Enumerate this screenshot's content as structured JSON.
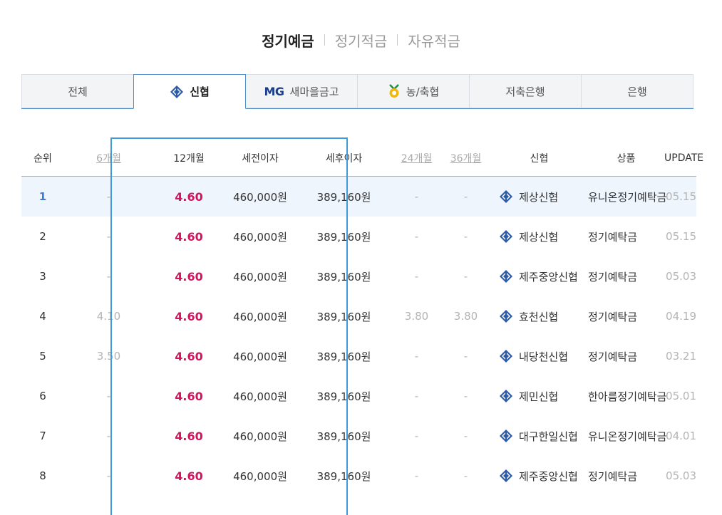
{
  "top_tabs": {
    "items": [
      {
        "label": "정기예금",
        "active": true
      },
      {
        "label": "정기적금",
        "active": false
      },
      {
        "label": "자유적금",
        "active": false
      }
    ]
  },
  "inst_tabs": {
    "all": "전체",
    "shinhyup": "신협",
    "mg_logo": "MG",
    "mg": "새마을금고",
    "nh": "농/축협",
    "savings": "저축은행",
    "bank": "은행",
    "icons": {
      "shinhyup": "shinhyup-logo-icon",
      "nh": "nonghyup-logo-icon"
    }
  },
  "table": {
    "headers": {
      "rank": "순위",
      "m6": "6개월",
      "m12": "12개월",
      "pre_tax": "세전이자",
      "post_tax": "세후이자",
      "m24": "24개월",
      "m36": "36개월",
      "bank": "신협",
      "product": "상품",
      "update": "UPDATE"
    },
    "rows": [
      {
        "rank": "1",
        "m6": "-",
        "m12": "4.60",
        "pre": "460,000원",
        "post": "389,160원",
        "m24": "-",
        "m36": "-",
        "bank": "제상신협",
        "product": "유니온정기예탁금",
        "update": "05.15"
      },
      {
        "rank": "2",
        "m6": "-",
        "m12": "4.60",
        "pre": "460,000원",
        "post": "389,160원",
        "m24": "-",
        "m36": "-",
        "bank": "제상신협",
        "product": "정기예탁금",
        "update": "05.15"
      },
      {
        "rank": "3",
        "m6": "-",
        "m12": "4.60",
        "pre": "460,000원",
        "post": "389,160원",
        "m24": "-",
        "m36": "-",
        "bank": "제주중앙신협",
        "product": "정기예탁금",
        "update": "05.03"
      },
      {
        "rank": "4",
        "m6": "4.10",
        "m12": "4.60",
        "pre": "460,000원",
        "post": "389,160원",
        "m24": "3.80",
        "m36": "3.80",
        "bank": "효천신협",
        "product": "정기예탁금",
        "update": "04.19"
      },
      {
        "rank": "5",
        "m6": "3.50",
        "m12": "4.60",
        "pre": "460,000원",
        "post": "389,160원",
        "m24": "-",
        "m36": "-",
        "bank": "내당천신협",
        "product": "정기예탁금",
        "update": "03.21"
      },
      {
        "rank": "6",
        "m6": "-",
        "m12": "4.60",
        "pre": "460,000원",
        "post": "389,160원",
        "m24": "-",
        "m36": "-",
        "bank": "제민신협",
        "product": "한아름정기예탁금",
        "update": "05.01"
      },
      {
        "rank": "7",
        "m6": "-",
        "m12": "4.60",
        "pre": "460,000원",
        "post": "389,160원",
        "m24": "-",
        "m36": "-",
        "bank": "대구한일신협",
        "product": "유니온정기예탁금",
        "update": "04.01"
      },
      {
        "rank": "8",
        "m6": "-",
        "m12": "4.60",
        "pre": "460,000원",
        "post": "389,160원",
        "m24": "-",
        "m36": "-",
        "bank": "제주중앙신협",
        "product": "정기예탁금",
        "update": "05.03"
      }
    ]
  },
  "colors": {
    "accent_blue": "#3f9ad8",
    "rate_red": "#d4145a",
    "highlight_row": "#eef5fc",
    "mg_navy": "#1b3f8f",
    "nh_yellow": "#f2b705"
  }
}
